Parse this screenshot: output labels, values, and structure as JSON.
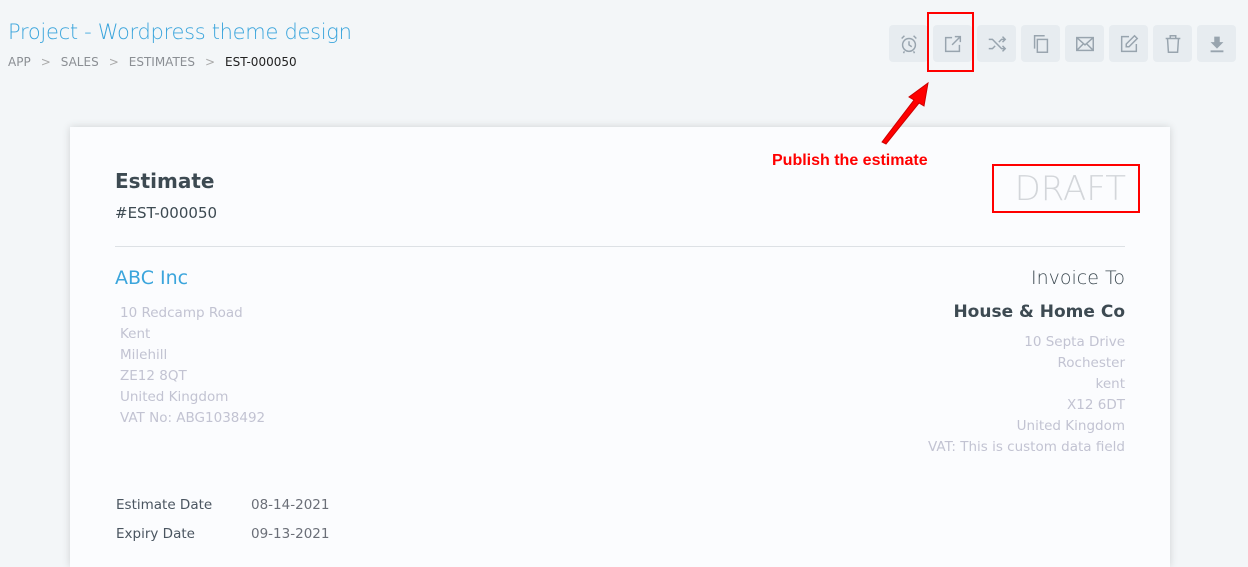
{
  "header": {
    "title": "Project - Wordpress theme design",
    "breadcrumb": [
      "APP",
      "SALES",
      "ESTIMATES",
      "EST-000050"
    ]
  },
  "toolbar": [
    {
      "icon": "alarm-clock-icon",
      "label": "Reminder"
    },
    {
      "icon": "share-icon",
      "label": "Publish"
    },
    {
      "icon": "shuffle-icon",
      "label": "Convert"
    },
    {
      "icon": "copy-icon",
      "label": "Clone"
    },
    {
      "icon": "mail-icon",
      "label": "Email"
    },
    {
      "icon": "edit-icon",
      "label": "Edit"
    },
    {
      "icon": "trash-icon",
      "label": "Delete"
    },
    {
      "icon": "download-icon",
      "label": "Download"
    }
  ],
  "annotation": {
    "text": "Publish the estimate",
    "color": "#ff0000"
  },
  "estimate": {
    "heading": "Estimate",
    "number": "#EST-000050",
    "status": "DRAFT",
    "from": {
      "name": "ABC Inc",
      "lines": [
        "10 Redcamp Road",
        "Kent",
        "Milehill",
        "ZE12 8QT",
        "United Kingdom",
        "VAT No: ABG1038492"
      ]
    },
    "to": {
      "label": "Invoice To",
      "name": "House & Home Co",
      "lines": [
        "10 Septa Drive",
        "Rochester",
        "kent",
        "X12 6DT",
        "United Kingdom",
        "VAT: This is custom data field"
      ]
    },
    "dates": [
      {
        "label": "Estimate Date",
        "value": "08-14-2021"
      },
      {
        "label": "Expiry Date",
        "value": "09-13-2021"
      }
    ]
  }
}
